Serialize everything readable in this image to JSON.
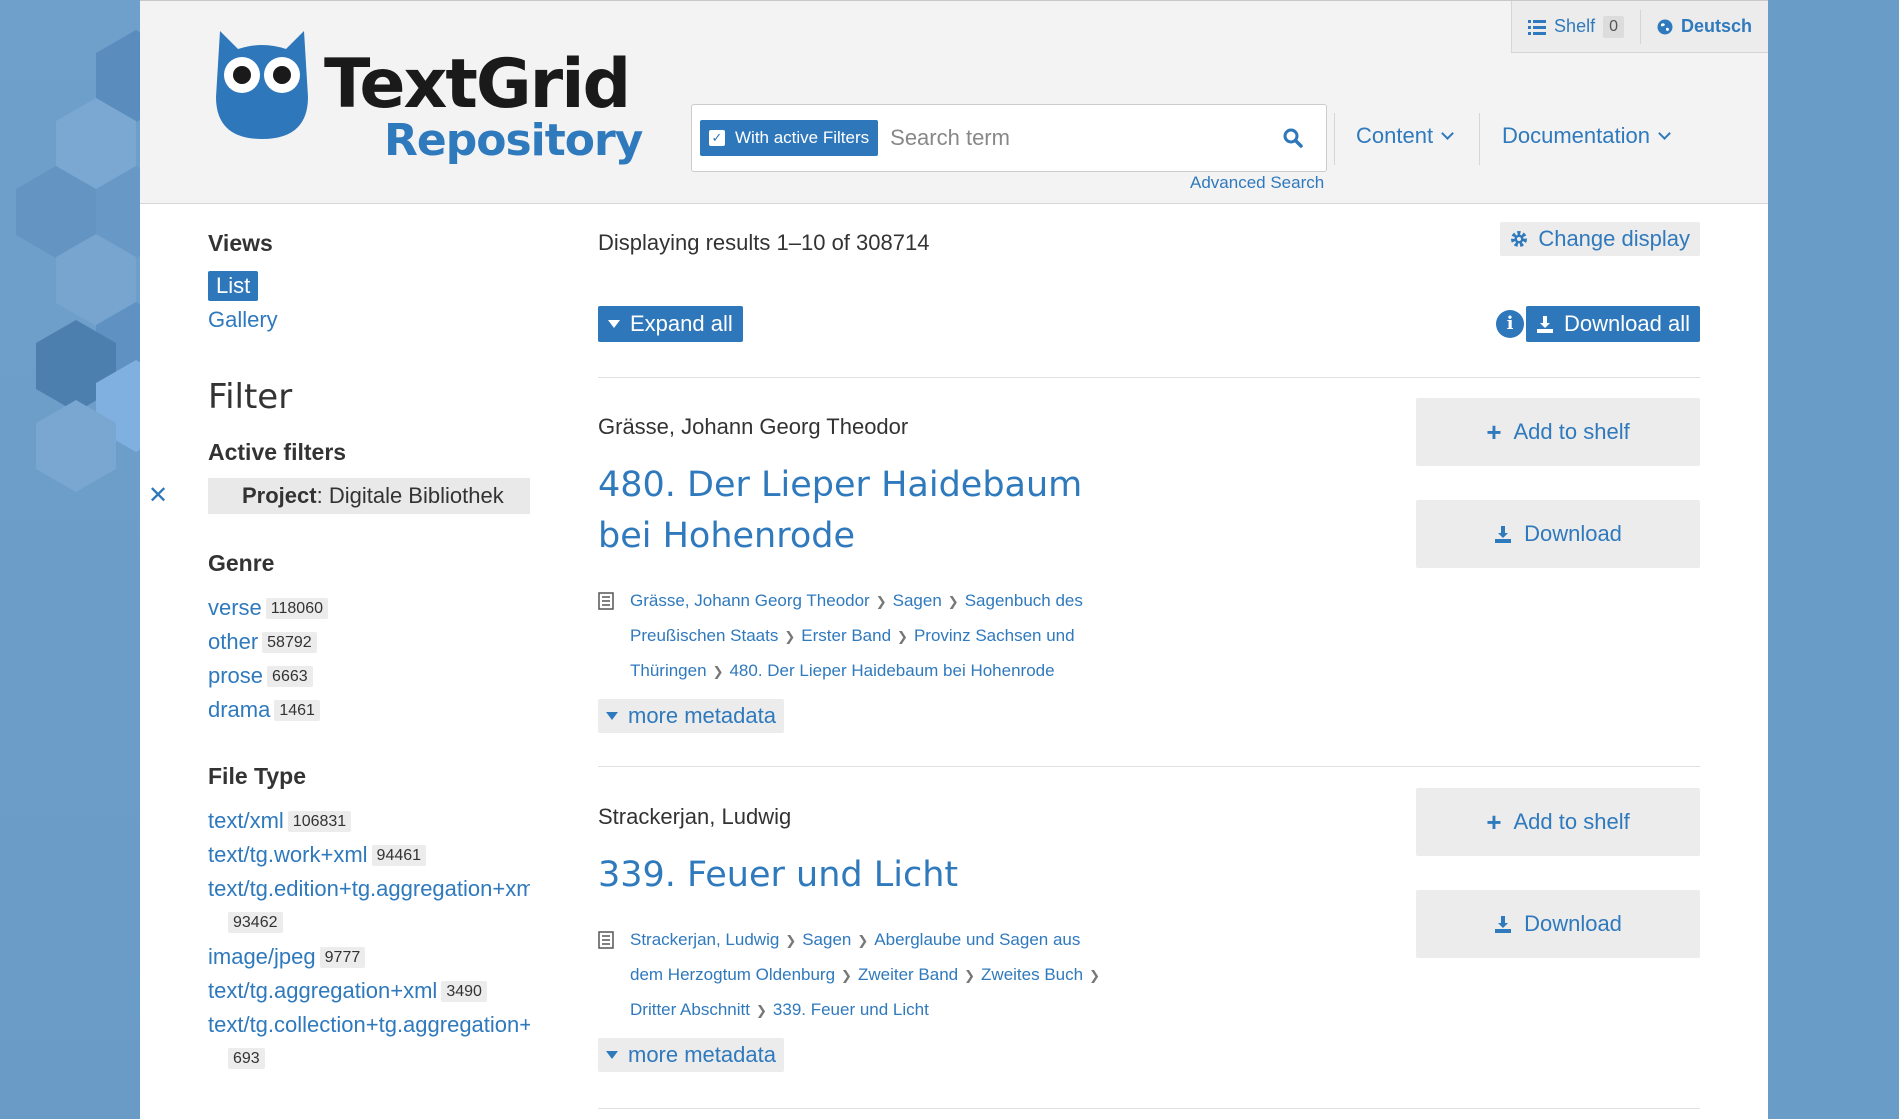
{
  "topbar": {
    "shelf_label": "Shelf",
    "shelf_count": "0",
    "language_label": "Deutsch"
  },
  "logo": {
    "line1": "TextGrid",
    "line2": "Repository"
  },
  "search": {
    "filter_toggle_label": "With active Filters",
    "placeholder": "Search term",
    "advanced_label": "Advanced Search"
  },
  "nav": {
    "content_label": "Content",
    "documentation_label": "Documentation"
  },
  "sidebar": {
    "views_heading": "Views",
    "view_list": "List",
    "view_gallery": "Gallery",
    "filter_heading": "Filter",
    "active_filters_heading": "Active filters",
    "active_filter": {
      "key": "Project",
      "value": ": Digitale Bibliothek"
    },
    "genre_heading": "Genre",
    "genres": [
      {
        "label": "verse",
        "count": "118060"
      },
      {
        "label": "other",
        "count": "58792"
      },
      {
        "label": "prose",
        "count": "6663"
      },
      {
        "label": "drama",
        "count": "1461"
      }
    ],
    "filetype_heading": "File Type",
    "filetypes": [
      {
        "label": "text/xml",
        "count": "106831"
      },
      {
        "label": "text/tg.work+xml",
        "count": "94461"
      },
      {
        "label": "text/tg.edition+tg.aggregation+xml",
        "count": "93462"
      },
      {
        "label": "image/jpeg",
        "count": "9777"
      },
      {
        "label": "text/tg.aggregation+xml",
        "count": "3490"
      },
      {
        "label": "text/tg.collection+tg.aggregation+xml",
        "count": "693"
      }
    ]
  },
  "main": {
    "results_info": "Displaying results 1–10 of 308714",
    "change_display_label": "Change display",
    "expand_all_label": "Expand all",
    "download_all_label": "Download all",
    "add_to_shelf_label": "Add to shelf",
    "download_label": "Download",
    "more_metadata_label": "more metadata",
    "results": [
      {
        "author": "Grässe, Johann Georg Theodor",
        "title": "480. Der Lieper Haidebaum bei Hohenrode",
        "crumbs": [
          "Grässe, Johann Georg Theodor",
          "Sagen",
          "Sagenbuch des Preußischen Staats",
          "Erster Band",
          "Provinz Sachsen und Thüringen",
          "480. Der Lieper Haidebaum bei Hohenrode"
        ]
      },
      {
        "author": "Strackerjan, Ludwig",
        "title": "339. Feuer und Licht",
        "crumbs": [
          "Strackerjan, Ludwig",
          "Sagen",
          "Aberglaube und Sagen aus dem Herzogtum Oldenburg",
          "Zweiter Band",
          "Zweites Buch",
          "Dritter Abschnitt",
          "339. Feuer und Licht"
        ]
      }
    ]
  },
  "colors": {
    "accent": "#2e77bb",
    "link": "#2f79bd",
    "background": "#6a9cc8"
  }
}
